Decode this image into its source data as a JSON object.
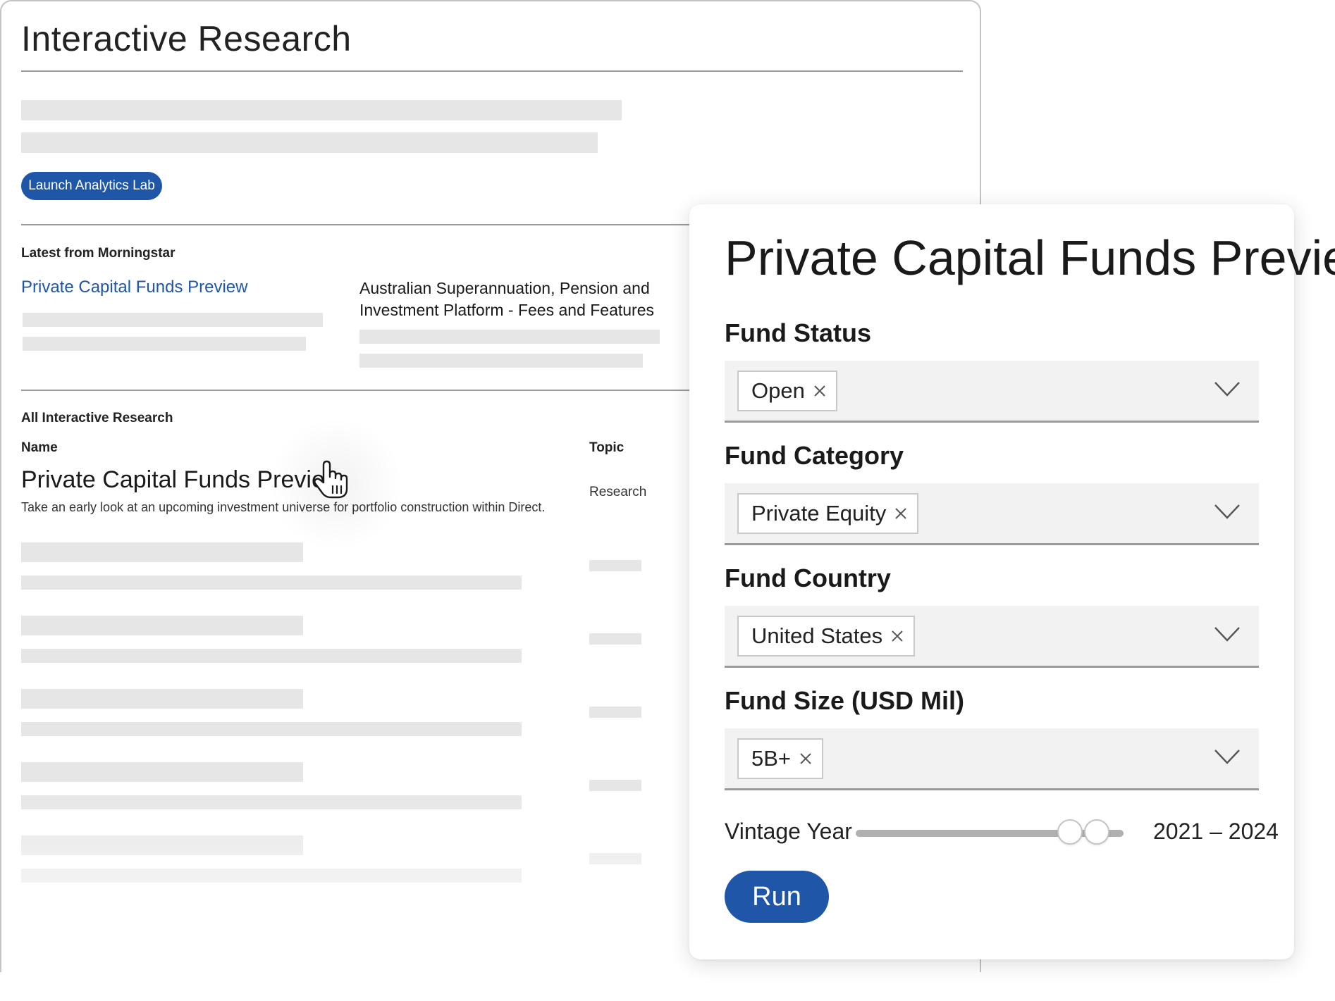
{
  "research_page": {
    "title": "Interactive Research",
    "launch_button": "Launch Analytics Lab",
    "latest_section": {
      "heading": "Latest from Morningstar",
      "items": [
        {
          "title": "Private Capital Funds Preview"
        },
        {
          "title": "Australian Superannuation, Pension and Investment Platform - Fees and Features"
        }
      ]
    },
    "all_section": {
      "heading": "All Interactive Research",
      "columns": {
        "name": "Name",
        "topic": "Topic"
      },
      "rows": [
        {
          "title": "Private Capital Funds Preview",
          "description": "Take an early look at an upcoming investment universe for portfolio construction within Direct.",
          "topic": "Research"
        }
      ]
    }
  },
  "panel": {
    "title": "Private Capital Funds Preview",
    "filters": [
      {
        "label": "Fund Status",
        "selected": "Open"
      },
      {
        "label": "Fund Category",
        "selected": "Private Equity"
      },
      {
        "label": "Fund Country",
        "selected": "United States"
      },
      {
        "label": "Fund Size (USD Mil)",
        "selected": "5B+"
      }
    ],
    "vintage_year": {
      "label": "Vintage Year",
      "value": "2021 – 2024",
      "range_fraction": [
        0.8,
        0.9
      ]
    },
    "run_button": "Run"
  },
  "colors": {
    "accent": "#1f56a8",
    "placeholder": "#e6e6e6",
    "field_bg": "#f2f2f2"
  },
  "icons": [
    "hand-pointer-icon",
    "close-icon",
    "chevron-down-icon"
  ]
}
